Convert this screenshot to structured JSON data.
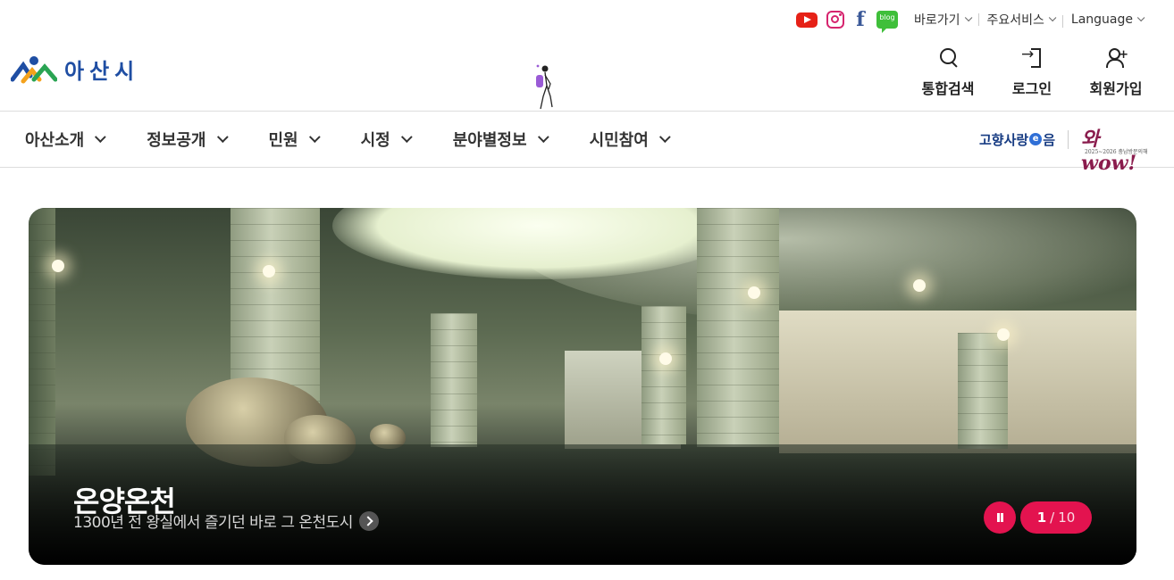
{
  "utility": {
    "sns": [
      {
        "name": "youtube",
        "icon": "youtube-icon",
        "color": "#e62117"
      },
      {
        "name": "instagram",
        "icon": "instagram-icon",
        "color": "#d6246e"
      },
      {
        "name": "facebook",
        "icon": "facebook-icon",
        "color": "#3b5998"
      },
      {
        "name": "blog",
        "icon": "blog-icon",
        "color": "#3fbf3a",
        "label": "blog"
      }
    ],
    "shortcut_label": "바로가기",
    "services_label": "주요서비스",
    "language_label": "Language"
  },
  "header": {
    "logo_text": "아산시",
    "search_label": "통합검색",
    "login_label": "로그인",
    "signup_label": "회원가입"
  },
  "nav": {
    "items": [
      {
        "label": "아산소개"
      },
      {
        "label": "정보공개"
      },
      {
        "label": "민원"
      },
      {
        "label": "시정"
      },
      {
        "label": "분야별정보"
      },
      {
        "label": "시민참여"
      }
    ],
    "gohyang_a": "고향사랑",
    "gohyang_e": "e",
    "gohyang_b": "음",
    "campaign_logo": "와wow!",
    "campaign_sub": "2025~2026 충남방문의해"
  },
  "hero": {
    "title": "온양온천",
    "subtitle": "1300년 전 왕실에서 즐기던 바로 그 온천도시",
    "current": "1",
    "separator": "/",
    "total": "10",
    "accent": "#e3134f"
  }
}
